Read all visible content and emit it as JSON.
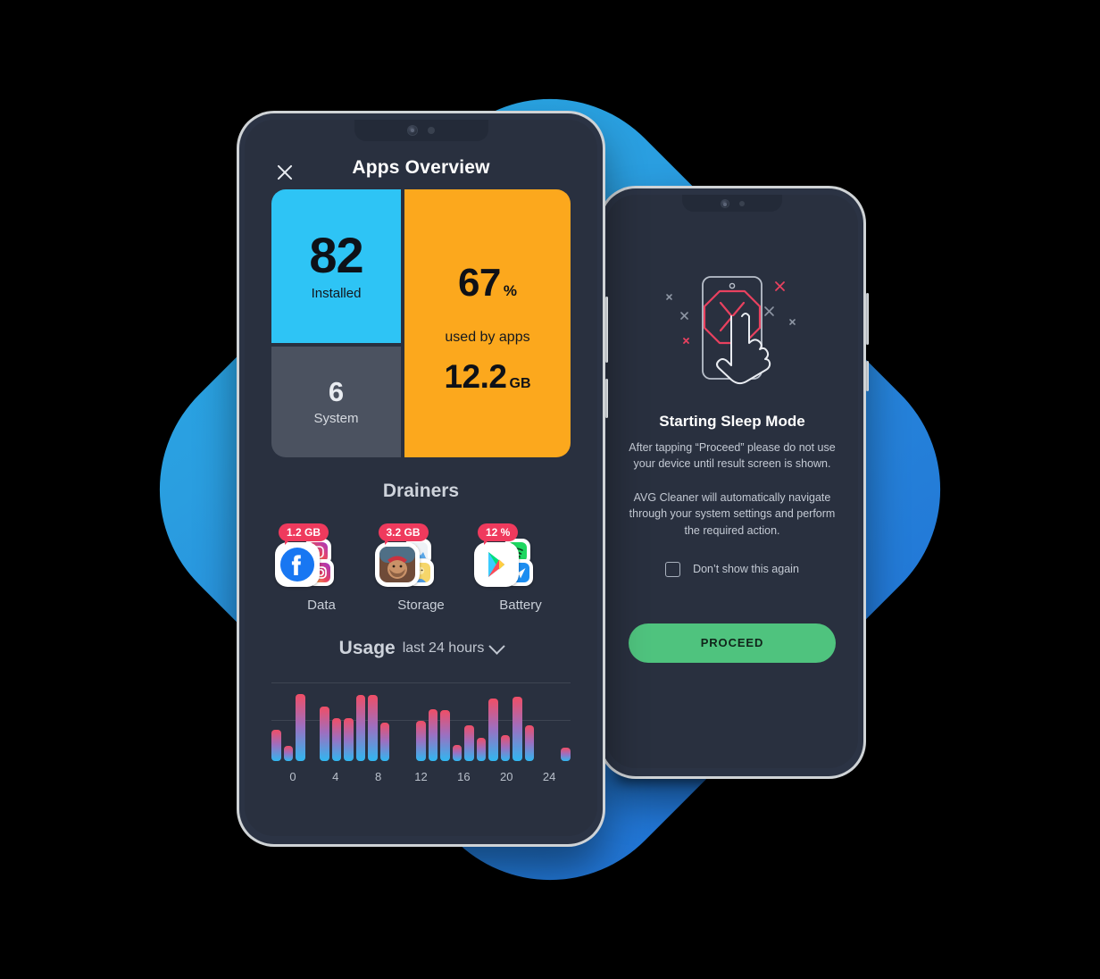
{
  "background": {
    "color_left": "#29a5e3",
    "color_right": "#2175d6"
  },
  "phone1": {
    "header": {
      "title": "Apps Overview",
      "close_icon": "close-icon"
    },
    "cards": {
      "installed": {
        "value": "82",
        "label": "Installed",
        "color": "#2ec4f5"
      },
      "system": {
        "value": "6",
        "label": "System",
        "color": "#4b5260"
      },
      "storage": {
        "percent_value": "67",
        "percent_unit": "%",
        "caption": "used by apps",
        "size_value": "12.2",
        "size_unit": "GB",
        "color": "#fca81d"
      }
    },
    "drainers": {
      "title": "Drainers",
      "items": [
        {
          "badge": "1.2 GB",
          "label": "Data",
          "front_icon": "facebook-icon",
          "back_icons": [
            "instagram-icon",
            "photo-app-icon"
          ]
        },
        {
          "badge": "3.2 GB",
          "label": "Storage",
          "front_icon": "game-pirate-icon",
          "back_icons": [
            "game-blue-icon",
            "game-yellow-icon"
          ]
        },
        {
          "badge": "12 %",
          "label": "Battery",
          "front_icon": "google-play-icon",
          "back_icons": [
            "spotify-icon",
            "messenger-icon"
          ]
        }
      ],
      "badge_color": "#ef3a5d"
    },
    "usage": {
      "title": "Usage",
      "subtitle": "last 24 hours",
      "chevron_icon": "chevron-down-icon"
    }
  },
  "phone2": {
    "illustration": "phone-stop-hand-icon",
    "title": "Starting Sleep Mode",
    "paragraph1": "After tapping “Proceed” please do not use your device until result screen is shown.",
    "paragraph2": "AVG Cleaner will automatically navigate through your system settings and perform the required action.",
    "checkbox_label": "Don’t show this again",
    "checkbox_checked": false,
    "proceed_label": "PROCEED",
    "proceed_color": "#4fc37e"
  },
  "chart_data": {
    "type": "bar",
    "title": "Usage",
    "subtitle": "last 24 hours",
    "xlabel": "",
    "ylabel": "",
    "categories": [
      "0",
      "1",
      "2",
      "3",
      "4",
      "5",
      "6",
      "7",
      "8",
      "9",
      "10",
      "11",
      "12",
      "13",
      "14",
      "15",
      "16",
      "17",
      "18",
      "19",
      "20",
      "21",
      "22",
      "23",
      "24"
    ],
    "tick_labels": [
      "0",
      "4",
      "8",
      "12",
      "16",
      "20",
      "24"
    ],
    "values": [
      38,
      18,
      82,
      0,
      66,
      52,
      52,
      80,
      80,
      47,
      0,
      0,
      49,
      63,
      62,
      20,
      43,
      28,
      76,
      31,
      78,
      44,
      0,
      0,
      16
    ],
    "ylim": [
      0,
      100
    ],
    "gridlines": [
      46,
      88
    ],
    "grid": true,
    "legend": "none",
    "bar_gradient_top": "#f04e66",
    "bar_gradient_mid": "#9d6fc0",
    "bar_gradient_bottom": "#30b7f0"
  }
}
